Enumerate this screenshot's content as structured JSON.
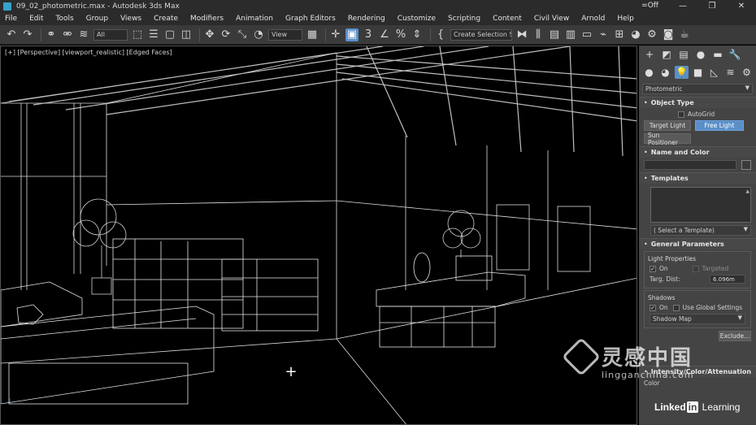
{
  "titlebar": {
    "title": "09_02_photometric.max - Autodesk 3ds Max",
    "right_text": "=Off",
    "minimize": "—",
    "restore": "❐",
    "close": "✕"
  },
  "menu": [
    "File",
    "Edit",
    "Tools",
    "Group",
    "Views",
    "Create",
    "Modifiers",
    "Animation",
    "Graph Editors",
    "Rendering",
    "Customize",
    "Scripting",
    "Content",
    "Civil View",
    "Arnold",
    "Help"
  ],
  "toolbar": {
    "selection_filter": "All",
    "coord_system": "View",
    "named_selection": "Create Selection Se"
  },
  "viewport": {
    "label": "[+] [Perspective] [viewport_realistic] [Edged Faces]"
  },
  "panel": {
    "category_dropdown": "Photometric",
    "object_type": {
      "title": "Object Type",
      "autogrid": "AutoGrid",
      "buttons": [
        "Target Light",
        "Free Light",
        "Sun Positioner"
      ]
    },
    "name_color": {
      "title": "Name and Color"
    },
    "templates": {
      "title": "Templates",
      "select": "( Select a Template)"
    },
    "general": {
      "title": "General Parameters",
      "light_props": "Light Properties",
      "on": "On",
      "targeted": "Targeted",
      "targ_dist_label": "Targ. Dist:",
      "targ_dist_value": "6.096m",
      "shadows": "Shadows",
      "shadows_on": "On",
      "use_global": "Use Global Settings",
      "shadow_type": "Shadow Map",
      "exclude": "Exclude..."
    },
    "intensity": {
      "title": "Intensity/Color/Attenuation",
      "color": "Color"
    }
  },
  "watermark": {
    "text": "灵感中国",
    "url": "lingganchina.com"
  },
  "linkedin": {
    "linked": "Linked",
    "in": "in",
    "learning": " Learning"
  }
}
